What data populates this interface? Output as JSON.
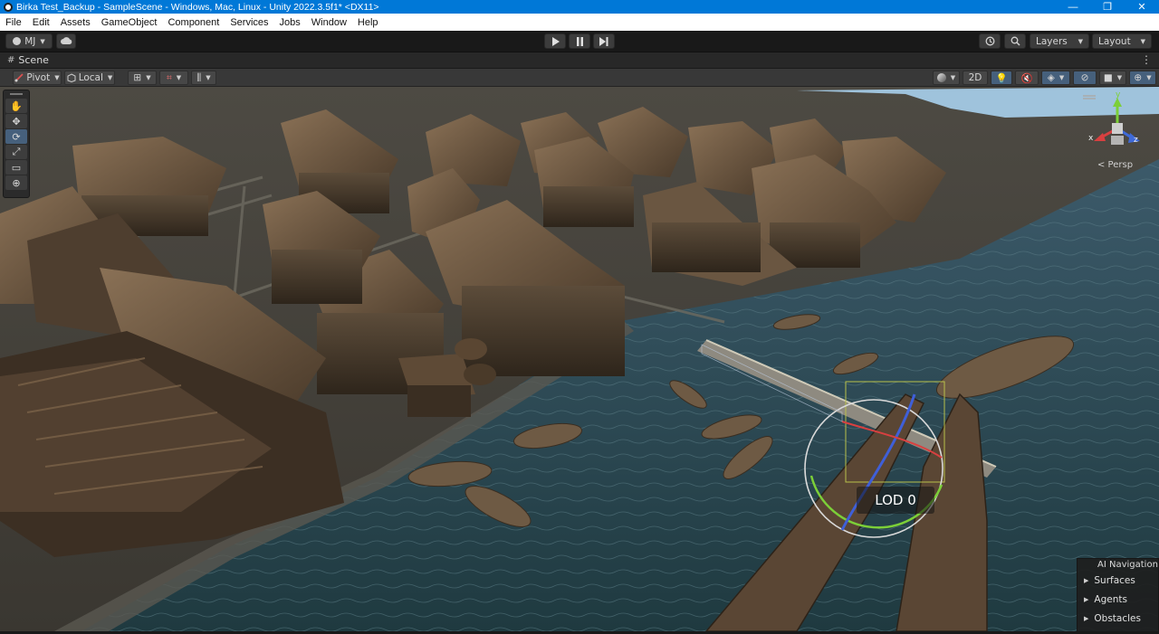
{
  "window": {
    "title": "Birka Test_Backup - SampleScene - Windows, Mac, Linux - Unity 2022.3.5f1* <DX11>",
    "minimize": "—",
    "maximize": "❐",
    "close": "✕"
  },
  "menu": [
    "File",
    "Edit",
    "Assets",
    "GameObject",
    "Component",
    "Services",
    "Jobs",
    "Window",
    "Help"
  ],
  "toolbar": {
    "account": "MJ",
    "layers": "Layers",
    "layout": "Layout"
  },
  "scene_tab": {
    "label": "Scene"
  },
  "scene_toolbar": {
    "pivot": "Pivot",
    "local": "Local",
    "mode_2d": "2D"
  },
  "viewport": {
    "lod_label": "LOD 0",
    "projection": "< Persp",
    "gizmo_axes": {
      "x": "x",
      "y": "y",
      "z": "z"
    }
  },
  "ai_navigation": {
    "title": "AI Navigation",
    "items": [
      "Surfaces",
      "Agents",
      "Obstacles"
    ]
  }
}
